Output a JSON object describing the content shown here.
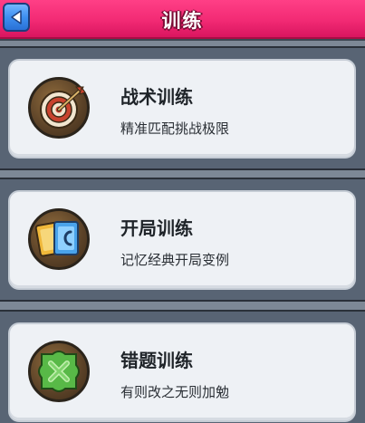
{
  "header": {
    "title": "训练",
    "back_icon": "back-arrow-icon"
  },
  "modes": [
    {
      "title": "战术训练",
      "description": "精准匹配挑战极限",
      "icon": "target-arrow-icon"
    },
    {
      "title": "开局训练",
      "description": "记忆经典开局变例",
      "icon": "cards-icon"
    },
    {
      "title": "错题训练",
      "description": "有则改之无则加勉",
      "icon": "puzzle-x-icon"
    }
  ],
  "colors": {
    "header": "#f22a74",
    "back_button": "#3d8ff0",
    "card": "#eef1f5",
    "panel": "#586474"
  }
}
